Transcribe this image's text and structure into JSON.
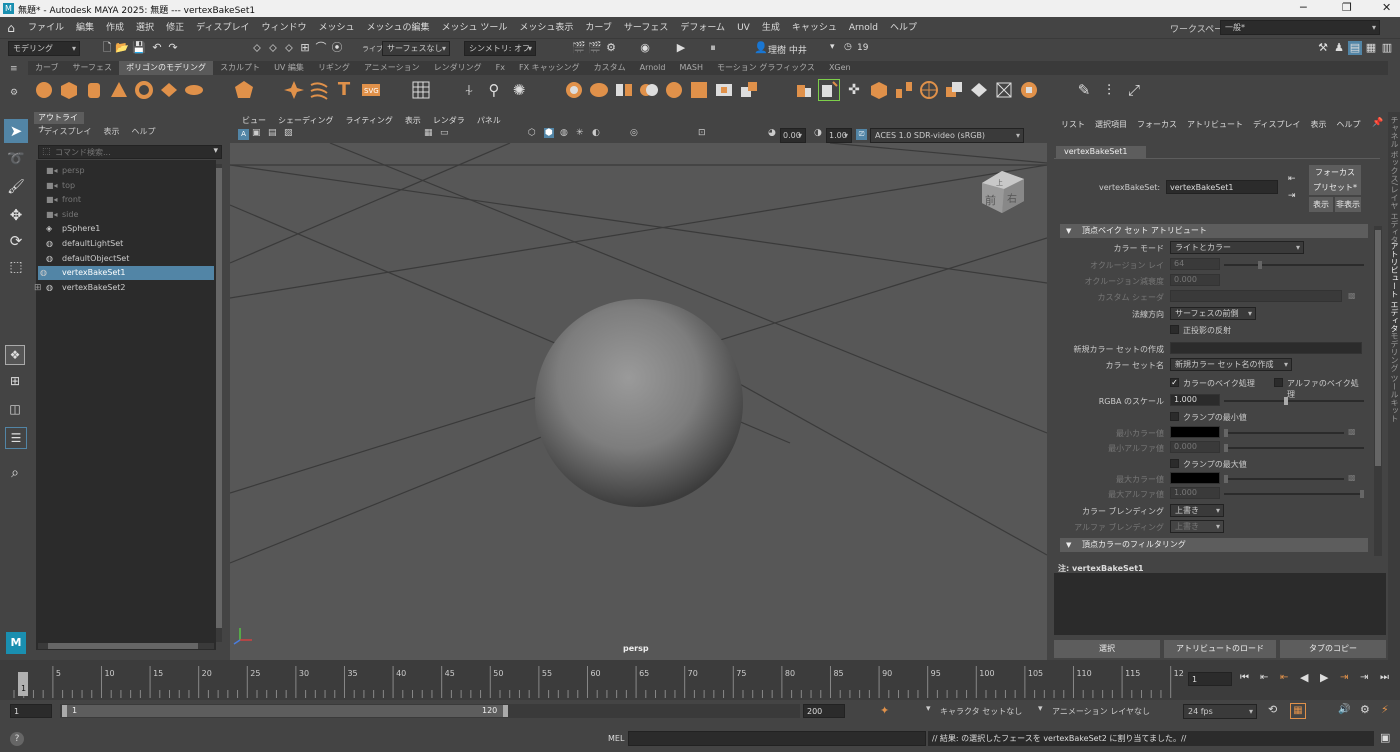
{
  "window": {
    "title": "無題* - Autodesk MAYA 2025: 無題   ---   vertexBakeSet1",
    "minimize": "─",
    "maximize": "❐",
    "close": "✕"
  },
  "menu": [
    "ファイル",
    "編集",
    "作成",
    "選択",
    "修正",
    "ディスプレイ",
    "ウィンドウ",
    "メッシュ",
    "メッシュの編集",
    "メッシュ ツール",
    "メッシュ表示",
    "カーブ",
    "サーフェス",
    "デフォーム",
    "UV",
    "生成",
    "キャッシュ",
    "Arnold",
    "ヘルプ"
  ],
  "workspace": {
    "label": "ワークスペース:",
    "value": "一般*"
  },
  "status_line": {
    "mode": "モデリング",
    "live": "ライブ",
    "live_value": "サーフェスなし",
    "symmetry": "シンメトリ: オフ",
    "user": "理樹 中井",
    "notifications": "19"
  },
  "shelf_tabs": [
    "カーブ",
    "サーフェス",
    "ポリゴンのモデリング",
    "スカルプト",
    "UV 編集",
    "リギング",
    "アニメーション",
    "レンダリング",
    "Fx",
    "FX キャッシング",
    "カスタム",
    "Arnold",
    "MASH",
    "モーション グラフィックス",
    "XGen"
  ],
  "shelf_active": 2,
  "outliner": {
    "title": "アウトライナ",
    "menu": [
      "ディスプレイ",
      "表示",
      "ヘルプ"
    ],
    "search_placeholder": "コマンド検索...",
    "items": [
      {
        "label": "persp",
        "dim": true
      },
      {
        "label": "top",
        "dim": true
      },
      {
        "label": "front",
        "dim": true
      },
      {
        "label": "side",
        "dim": true
      },
      {
        "label": "pSphere1",
        "dim": false
      },
      {
        "label": "defaultLightSet",
        "dim": false
      },
      {
        "label": "defaultObjectSet",
        "dim": false
      },
      {
        "label": "vertexBakeSet1",
        "dim": false,
        "selected": true
      },
      {
        "label": "vertexBakeSet2",
        "dim": false
      }
    ]
  },
  "viewport": {
    "menu": [
      "ビュー",
      "シェーディング",
      "ライティング",
      "表示",
      "レンダラ",
      "パネル"
    ],
    "exposure": "0.00",
    "gamma": "1.00",
    "colorspace": "ACES 1.0 SDR-video (sRGB)",
    "camera_label": "persp",
    "viewcube_front": "前",
    "viewcube_right": "右",
    "viewcube_top": "上"
  },
  "attribute_editor": {
    "menu": [
      "リスト",
      "選択項目",
      "フォーカス",
      "アトリビュート",
      "ディスプレイ",
      "表示",
      "ヘルプ"
    ],
    "tab": "vertexBakeSet1",
    "node_label": "vertexBakeSet:",
    "node_value": "vertexBakeSet1",
    "focus_btn": "フォーカス",
    "preset_btn": "プリセット*",
    "show_btn": "表示",
    "hide_btn": "非表示",
    "section1": "頂点ベイク セット アトリビュート",
    "color_mode_label": "カラー モード",
    "color_mode_value": "ライトとカラー",
    "occlusion_rays_label": "オクルージョン レイ",
    "occlusion_rays_value": "64",
    "occlusion_falloff_label": "オクルージョン減衰度",
    "occlusion_falloff_value": "0.000",
    "custom_shader_label": "カスタム シェーダ",
    "normal_dir_label": "法線方向",
    "normal_dir_value": "サーフェスの前側",
    "orthographic_reflection": "正投影の反射",
    "new_color_set_label": "新規カラー セットの作成",
    "color_set_name_label": "カラー セット名",
    "color_set_name_value": "新規カラー セット名の作成",
    "bake_color": "カラーのベイク処理",
    "bake_alpha": "アルファのベイク処理",
    "rgba_scale_label": "RGBA のスケール",
    "rgba_scale_value": "1.000",
    "clamp_min": "クランプの最小値",
    "min_color_label": "最小カラー値",
    "min_alpha_label": "最小アルファ値",
    "min_alpha_value": "0.000",
    "clamp_max": "クランプの最大値",
    "max_color_label": "最大カラー値",
    "max_alpha_label": "最大アルファ値",
    "max_alpha_value": "1.000",
    "color_blend_label": "カラー ブレンディング",
    "color_blend_value": "上書き",
    "alpha_blend_label": "アルファ ブレンディング",
    "alpha_blend_value": "上書き",
    "section2": "頂点カラーのフィルタリング",
    "notes_label": "注: vertexBakeSet1",
    "select_btn": "選択",
    "load_attr_btn": "アトリビュートのロード",
    "copy_tab_btn": "タブのコピー"
  },
  "right_tabs": [
    "チャネル ボックス/レイヤ エディタ",
    "アトリビュート エディタ",
    "モデリング ツールキット"
  ],
  "timeline": {
    "ticks": [
      "5",
      "10",
      "15",
      "20",
      "25",
      "30",
      "35",
      "40",
      "45",
      "50",
      "55",
      "60",
      "65",
      "70",
      "75",
      "80",
      "85",
      "90",
      "95",
      "100",
      "105",
      "110",
      "115",
      "12"
    ],
    "start_frame": "1",
    "current_frame": "1"
  },
  "range": {
    "start": "1",
    "inner_start": "1",
    "inner_end": "120",
    "end": "200",
    "character_set": "キャラクタ セットなし",
    "anim_layer": "アニメーション レイヤなし",
    "fps": "24 fps"
  },
  "command": {
    "lang": "MEL",
    "result": "// 結果:  の選択したフェースを vertexBakeSet2 に割り当てました。//"
  },
  "colors": {
    "accent": "#5285a6",
    "shelf_orange": "#e0914a",
    "bg": "#444444"
  }
}
